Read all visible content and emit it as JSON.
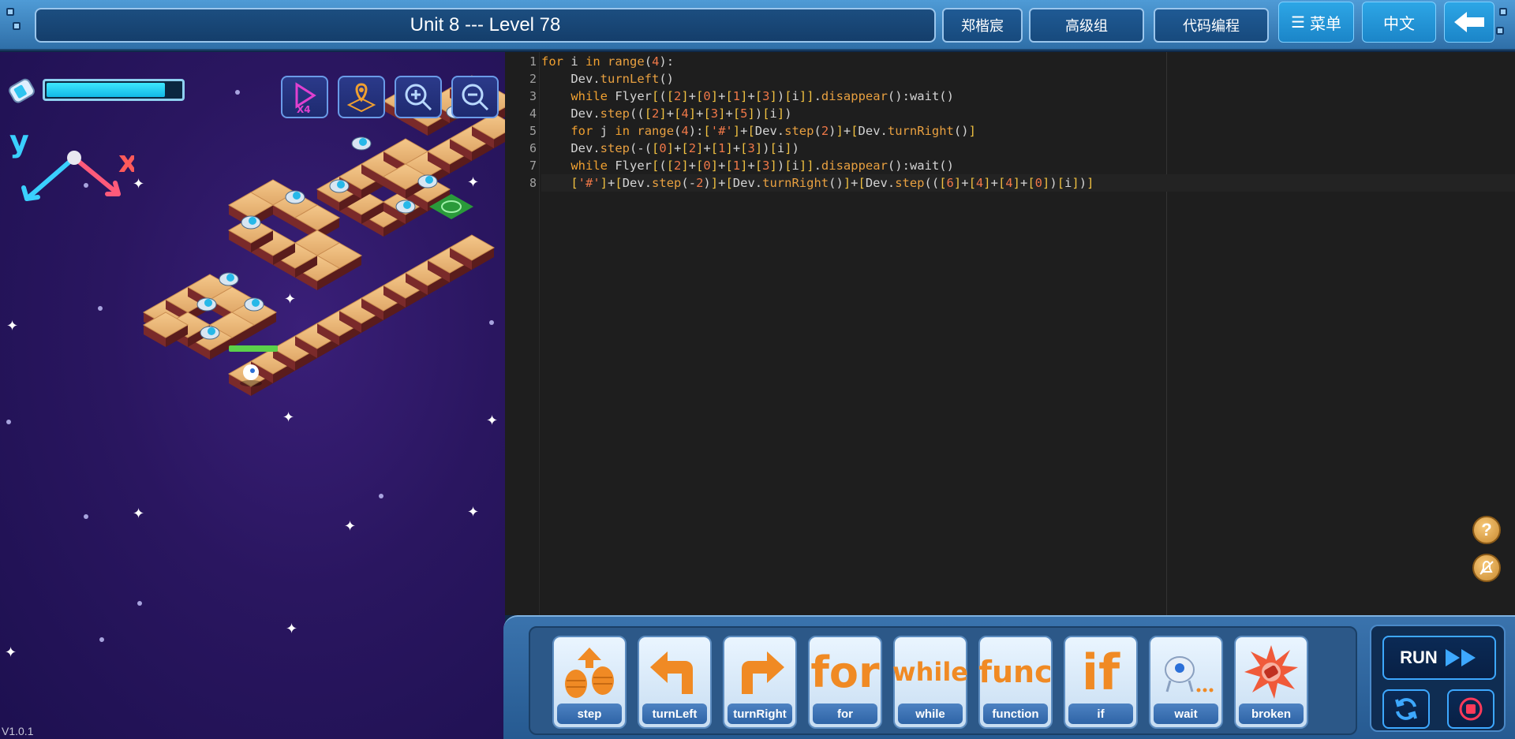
{
  "header": {
    "title": "Unit 8 --- Level 78",
    "user": "郑楷宸",
    "group": "高级组",
    "mode": "代码编程",
    "menu": "菜单",
    "language": "中文"
  },
  "game": {
    "energy_level": 0.88,
    "axis_y": "y",
    "axis_x": "x",
    "speed_label": "X4",
    "version": "V1.0.1"
  },
  "editor": {
    "line_numbers": [
      "1",
      "2",
      "3",
      "4",
      "5",
      "6",
      "7",
      "8"
    ],
    "lines": [
      "for i in range(4):",
      "    Dev.turnLeft()",
      "    while Flyer[([2]+[0]+[1]+[3])[i]].disappear():wait()",
      "    Dev.step(([2]+[4]+[3]+[5])[i])",
      "    for j in range(4):['#']+[Dev.step(2)]+[Dev.turnRight()]",
      "    Dev.step(-([0]+[2]+[1]+[3])[i])",
      "    while Flyer[([2]+[0]+[1]+[3])[i]].disappear():wait()",
      "    ['#']+[Dev.step(-2)]+[Dev.turnRight()]+[Dev.step(([6]+[4]+[4]+[0])[i])]"
    ]
  },
  "palette": {
    "blocks": [
      {
        "label": "step",
        "icon": "step-feet-icon"
      },
      {
        "label": "turnLeft",
        "icon": "turn-left-arrow-icon"
      },
      {
        "label": "turnRight",
        "icon": "turn-right-arrow-icon"
      },
      {
        "label": "for",
        "icon": "for-word-icon",
        "word": "for"
      },
      {
        "label": "while",
        "icon": "while-word-icon",
        "word": "while"
      },
      {
        "label": "function",
        "icon": "func-word-icon",
        "word": "func"
      },
      {
        "label": "if",
        "icon": "if-word-icon",
        "word": "if"
      },
      {
        "label": "wait",
        "icon": "robot-wait-icon"
      },
      {
        "label": "broken",
        "icon": "broken-burst-icon"
      }
    ],
    "run_label": "RUN"
  },
  "colors": {
    "accent": "#2da6e6",
    "keyword": "#f0a030",
    "number": "#f08050",
    "method": "#f0a030"
  }
}
